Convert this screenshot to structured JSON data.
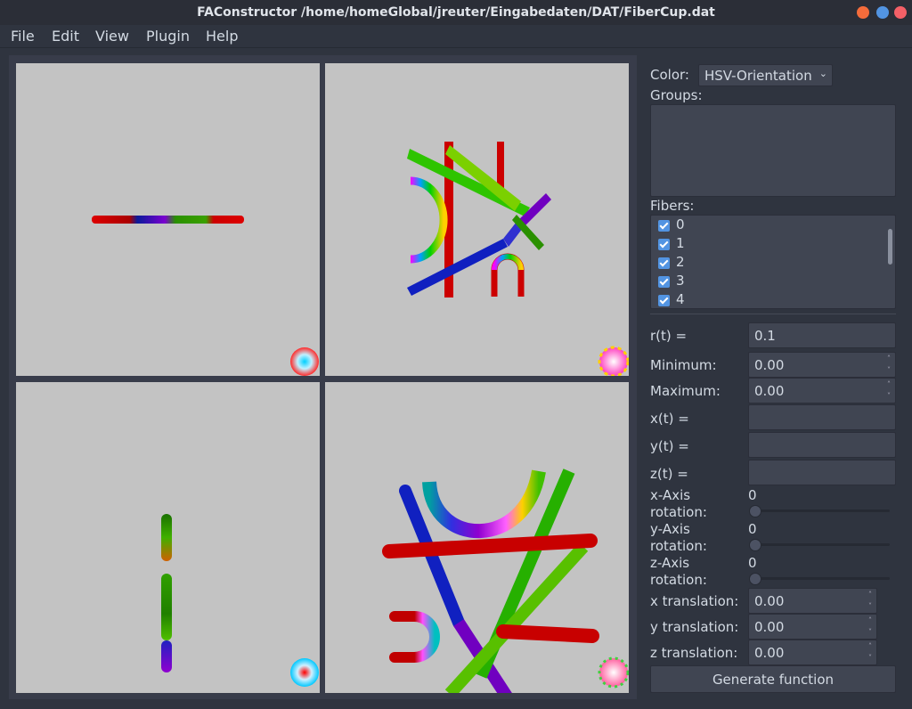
{
  "window": {
    "title": "FAConstructor /home/homeGlobal/jreuter/Eingabedaten/DAT/FiberCup.dat",
    "buttons": [
      "minimize-icon",
      "maximize-icon",
      "close-icon"
    ],
    "button_colors": [
      "#f46c3b",
      "#5294e2",
      "#f46067"
    ]
  },
  "menu": [
    "File",
    "Edit",
    "View",
    "Plugin",
    "Help"
  ],
  "panel": {
    "color_label": "Color:",
    "color_value": "HSV-Orientation",
    "groups_label": "Groups:",
    "fibers_label": "Fibers:",
    "fibers": [
      "0",
      "1",
      "2",
      "3",
      "4"
    ],
    "r_label": "r(t) =",
    "r_value": "0.1",
    "minimum_label": "Minimum:",
    "minimum_value": "0.00",
    "maximum_label": "Maximum:",
    "maximum_value": "0.00",
    "x_label": "x(t) =",
    "y_label": "y(t) =",
    "z_label": "z(t) =",
    "xrot_label1": "x-Axis",
    "xrot_label2": "rotation:",
    "xrot_value": "0",
    "yrot_label1": "y-Axis",
    "yrot_label2": "rotation:",
    "yrot_value": "0",
    "zrot_label1": "z-Axis",
    "zrot_label2": "rotation:",
    "zrot_value": "0",
    "xtrans_label": "x translation:",
    "xtrans_value": "0.00",
    "ytrans_label": "y translation:",
    "ytrans_value": "0.00",
    "ztrans_label": "z translation:",
    "ztrans_value": "0.00",
    "generate_label": "Generate function"
  },
  "viewports": [
    "viewport-top-left",
    "viewport-top-right",
    "viewport-bottom-left",
    "viewport-bottom-right (3D)"
  ],
  "colors": {
    "background": "#2f343f",
    "viewport": "#c3c3c3",
    "accent": "#5294e2"
  }
}
